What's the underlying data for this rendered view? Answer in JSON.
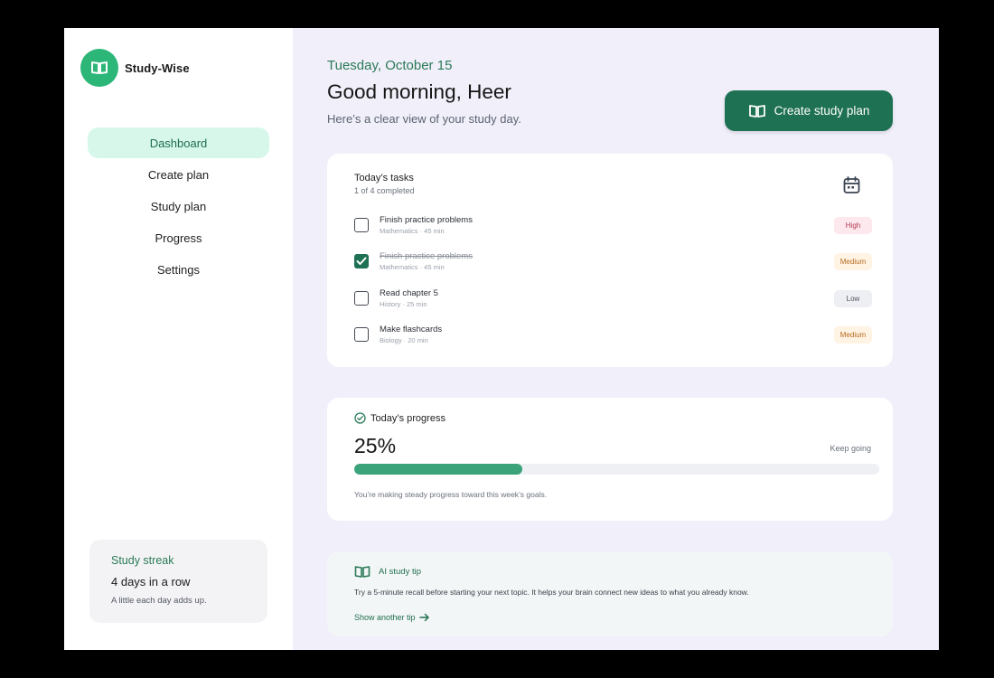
{
  "brand": {
    "name": "Study-Wise",
    "logo_icon": "book-icon",
    "logo_color": "#2cb678"
  },
  "nav": {
    "items": [
      {
        "label": "Dashboard",
        "active": true
      },
      {
        "label": "Create plan",
        "active": false
      },
      {
        "label": "Study plan",
        "active": false
      },
      {
        "label": "Progress",
        "active": false
      },
      {
        "label": "Settings",
        "active": false
      }
    ]
  },
  "streak": {
    "title": "Study streak",
    "value": "4 days in a row",
    "subtitle": "A little each day adds up."
  },
  "header": {
    "date": "Tuesday, October 15",
    "greeting": "Good morning, Heer",
    "subtitle": "Here’s a clear view of your study day."
  },
  "cta": {
    "label": "Create study plan",
    "icon": "book-open-icon",
    "color": "#1f7154"
  },
  "tasks": {
    "title": "Today’s tasks",
    "count": "1 of 4 completed",
    "icon": "calendar-icon",
    "items": [
      {
        "name": "Finish practice problems",
        "meta": "Mathematics · 45 min",
        "priority": "High",
        "priority_level": "high",
        "done": false
      },
      {
        "name": "Finish practice problems",
        "meta": "Mathematics · 45 min",
        "priority": "Medium",
        "priority_level": "medium",
        "done": true
      },
      {
        "name": "Read chapter 5",
        "meta": "History · 25 min",
        "priority": "Low",
        "priority_level": "low",
        "done": false
      },
      {
        "name": "Make flashcards",
        "meta": "Biology · 20 min",
        "priority": "Medium",
        "priority_level": "medium",
        "done": false
      }
    ]
  },
  "progress": {
    "title": "Today’s progress",
    "value": "25%",
    "fraction": 0.32,
    "note": "Keep going",
    "caption": "You’re making steady progress toward this week’s goals.",
    "fill_color": "#3aa37a"
  },
  "tip": {
    "title": "AI study tip",
    "body": "Try a 5-minute recall before starting your next topic. It helps your brain connect new ideas to what you already know.",
    "link": "Show another tip"
  }
}
